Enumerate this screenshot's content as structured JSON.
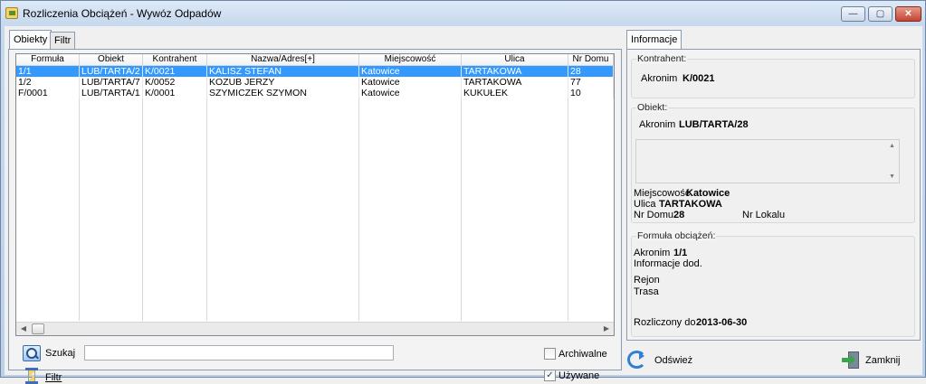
{
  "window": {
    "title": "Rozliczenia Obciążeń - Wywóz Odpadów",
    "buttons": {
      "minimize": "—",
      "maximize": "▢",
      "close": "✕"
    }
  },
  "left_tabs": [
    {
      "label": "Obiekty"
    },
    {
      "label": "Filtr"
    }
  ],
  "grid": {
    "columns": [
      "Formuła",
      "Obiekt",
      "Kontrahent",
      "Nazwa/Adres[+]",
      "Miejscowość",
      "Ulica",
      "Nr Domu"
    ],
    "rows": [
      [
        "1/1",
        "LUB/TARTA/2",
        "K/0021",
        "KALISZ STEFAN",
        "Katowice",
        "TARTAKOWA",
        "28"
      ],
      [
        "1/2",
        "LUB/TARTA/7",
        "K/0052",
        "KOZUB JERZY",
        "Katowice",
        "TARTAKOWA",
        "77"
      ],
      [
        "F/0001",
        "LUB/TARTA/1",
        "K/0001",
        "SZYMICZEK SZYMON",
        "Katowice",
        "KUKUŁEK",
        "10"
      ]
    ],
    "selected_row": 0
  },
  "search": {
    "label": "Szukaj",
    "value": ""
  },
  "filter": {
    "label": "Filtr"
  },
  "checkboxes": {
    "archiwalne": {
      "label": "Archiwalne",
      "checked": false
    },
    "uzywane": {
      "label": "Używane",
      "checked": true
    }
  },
  "right_tab": {
    "label": "Informacje"
  },
  "info": {
    "kontrahent": {
      "group_title": "Kontrahent:",
      "akronim_label": "Akronim",
      "akronim": "K/0021"
    },
    "obiekt": {
      "group_title": "Obiekt:",
      "akronim_label": "Akronim",
      "akronim": "LUB/TARTA/28",
      "miejscowosc_label": "Miejscowość",
      "miejscowosc": "Katowice",
      "ulica_label": "Ulica",
      "ulica": "TARTAKOWA",
      "nr_domu_label": "Nr Domu",
      "nr_domu": "28",
      "nr_lokalu_label": "Nr Lokalu",
      "nr_lokalu": ""
    },
    "formula": {
      "group_title": "Formuła obciążeń:",
      "akronim_label": "Akronim",
      "akronim": "1/1",
      "info_label": "Informacje dod.",
      "rejon_label": "Rejon",
      "trasa_label": "Trasa",
      "rozliczony_label": "Rozliczony do",
      "rozliczony": "2013-06-30"
    }
  },
  "actions": {
    "refresh": "Odśwież",
    "close": "Zamknij"
  }
}
